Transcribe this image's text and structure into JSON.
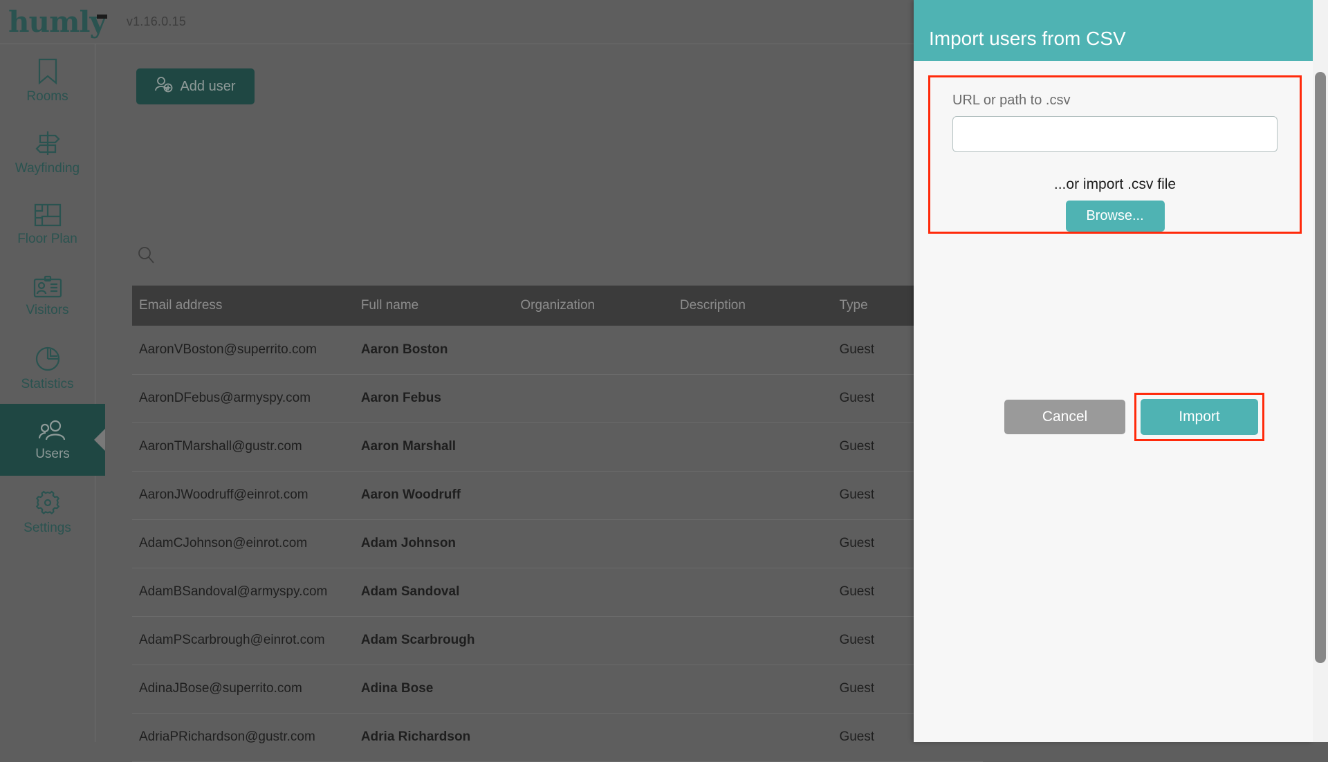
{
  "app": {
    "brand": "humly",
    "version": "v1.16.0.15"
  },
  "sidebar": {
    "items": [
      {
        "label": "Rooms",
        "icon": "bookmark-icon",
        "active": false
      },
      {
        "label": "Wayfinding",
        "icon": "signpost-icon",
        "active": false
      },
      {
        "label": "Floor Plan",
        "icon": "floorplan-icon",
        "active": false
      },
      {
        "label": "Visitors",
        "icon": "id-badge-icon",
        "active": false
      },
      {
        "label": "Statistics",
        "icon": "pie-chart-icon",
        "active": false
      },
      {
        "label": "Users",
        "icon": "users-icon",
        "active": true
      },
      {
        "label": "Settings",
        "icon": "gear-icon",
        "active": false
      }
    ]
  },
  "toolbar": {
    "add_user_label": "Add user",
    "search_icon": "search-icon"
  },
  "table": {
    "columns": [
      "Email address",
      "Full name",
      "Organization",
      "Description",
      "Type"
    ],
    "rows": [
      {
        "email": "AaronVBoston@superrito.com",
        "name": "Aaron Boston",
        "organization": "",
        "description": "",
        "type": "Guest"
      },
      {
        "email": "AaronDFebus@armyspy.com",
        "name": "Aaron Febus",
        "organization": "",
        "description": "",
        "type": "Guest"
      },
      {
        "email": "AaronTMarshall@gustr.com",
        "name": "Aaron Marshall",
        "organization": "",
        "description": "",
        "type": "Guest"
      },
      {
        "email": "AaronJWoodruff@einrot.com",
        "name": "Aaron Woodruff",
        "organization": "",
        "description": "",
        "type": "Guest"
      },
      {
        "email": "AdamCJohnson@einrot.com",
        "name": "Adam Johnson",
        "organization": "",
        "description": "",
        "type": "Guest"
      },
      {
        "email": "AdamBSandoval@armyspy.com",
        "name": "Adam Sandoval",
        "organization": "",
        "description": "",
        "type": "Guest"
      },
      {
        "email": "AdamPScarbrough@einrot.com",
        "name": "Adam Scarbrough",
        "organization": "",
        "description": "",
        "type": "Guest"
      },
      {
        "email": "AdinaJBose@superrito.com",
        "name": "Adina Bose",
        "organization": "",
        "description": "",
        "type": "Guest"
      },
      {
        "email": "AdriaPRichardson@gustr.com",
        "name": "Adria Richardson",
        "organization": "",
        "description": "",
        "type": "Guest"
      }
    ]
  },
  "modal": {
    "title": "Import users from CSV",
    "url_label": "URL or path to .csv",
    "url_value": "",
    "url_placeholder": "",
    "or_text": "...or import .csv file",
    "browse_label": "Browse...",
    "cancel_label": "Cancel",
    "import_label": "Import"
  },
  "colors": {
    "brand_teal": "#4fb3b3",
    "dark_teal": "#1f4743",
    "highlight_red": "#ff2a0b",
    "overlay_gray": "#5e5e5e",
    "header_row": "#3b3b3b"
  }
}
